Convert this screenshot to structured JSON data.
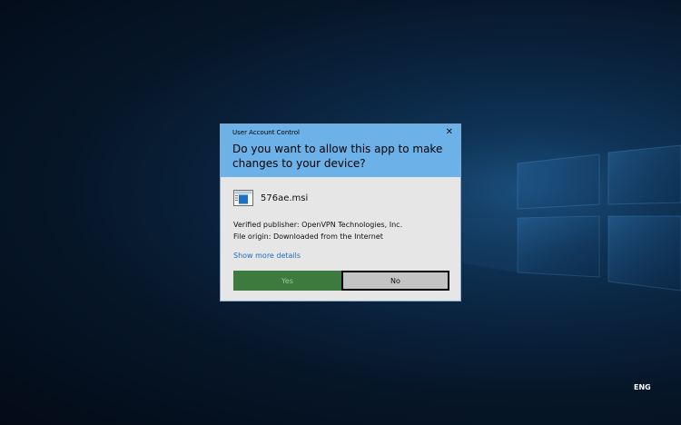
{
  "desktop": {
    "language_indicator": "ENG"
  },
  "uac": {
    "caption": "User Account Control",
    "close_icon": "close-icon",
    "question": "Do you want to allow this app to make changes to your device?",
    "file_icon": "installer-file-icon",
    "file_name": "576ae.msi",
    "publisher": "Verified publisher: OpenVPN Technologies, Inc.",
    "origin": "File origin: Downloaded from the Internet",
    "details_link": "Show more details",
    "yes_label": "Yes",
    "no_label": "No",
    "colors": {
      "header": "#6cb2e9",
      "yes_button": "#3c7a3e",
      "no_button": "#c4c4c4",
      "link": "#1a6fc1"
    }
  }
}
